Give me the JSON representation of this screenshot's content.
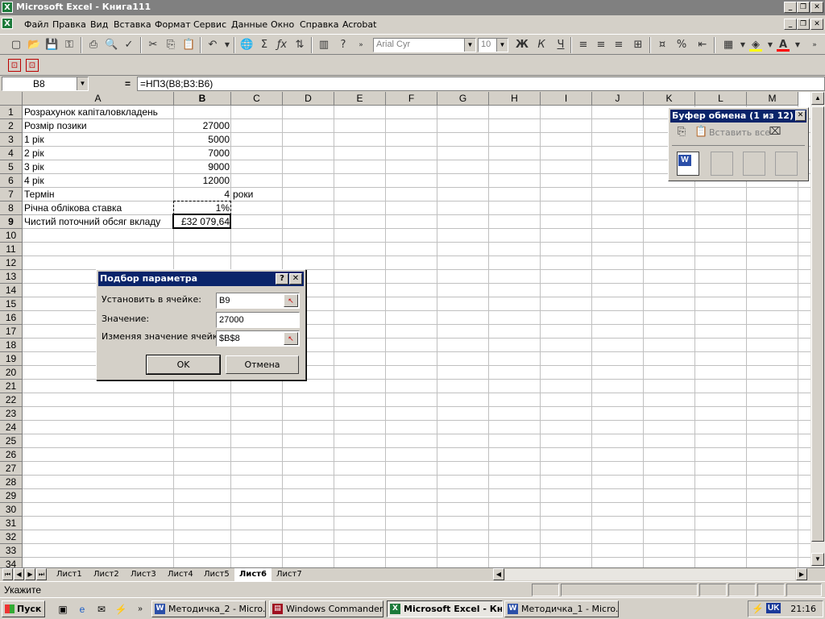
{
  "window": {
    "title": "Microsoft Excel - Книга111",
    "app_icon": "excel-icon"
  },
  "menu": [
    "Файл",
    "Правка",
    "Вид",
    "Вставка",
    "Формат",
    "Сервис",
    "Данные",
    "Окно",
    "Справка",
    "Acrobat"
  ],
  "toolbar": {
    "font_name": "Arial Cyr",
    "font_size": "10"
  },
  "formula_bar": {
    "name_box": "B8",
    "equals": "=",
    "formula": "=НПЗ(B8;B3:B6)"
  },
  "columns": [
    "A",
    "B",
    "C",
    "D",
    "E",
    "F",
    "G",
    "H",
    "I",
    "J",
    "K",
    "L",
    "M"
  ],
  "rows": [
    "1",
    "2",
    "3",
    "4",
    "5",
    "6",
    "7",
    "8",
    "9",
    "10",
    "11",
    "12",
    "13",
    "14",
    "15",
    "16",
    "17",
    "18",
    "19",
    "20",
    "21",
    "22",
    "23",
    "24",
    "25",
    "26",
    "27",
    "28",
    "29",
    "30",
    "31",
    "32",
    "33",
    "34"
  ],
  "cells": {
    "A1": "Розрахунок капіталовкладень",
    "A2": "Розмір позики",
    "B2": "27000",
    "A3": "1 рік",
    "B3": "5000",
    "A4": "2 рік",
    "B4": "7000",
    "A5": "3 рік",
    "B5": "9000",
    "A6": "4 рік",
    "B6": "12000",
    "A7": "Термін",
    "B7": "4",
    "C7": "роки",
    "A8": "Річна облікова ставка",
    "B8": "1%",
    "A9": "Чистий поточний обсяг вкладу",
    "B9": "£32 079,64"
  },
  "dialog": {
    "title": "Подбор параметра",
    "set_cell_label": "Установить в ячейке:",
    "set_cell_value": "B9",
    "value_label": "Значение:",
    "value_value": "27000",
    "changing_label": "Изменяя значение ячейки:",
    "changing_value": "$B$8",
    "ok": "OK",
    "cancel": "Отмена"
  },
  "clipboard": {
    "title": "Буфер обмена (1 из 12)",
    "paste_all": "Вставить все"
  },
  "sheets": [
    "Лист1",
    "Лист2",
    "Лист3",
    "Лист4",
    "Лист5",
    "Лист6",
    "Лист7"
  ],
  "active_sheet": "Лист6",
  "status": "Укажите",
  "taskbar": {
    "start": "Пуск",
    "tasks": [
      "Методичка_2 - Micro...",
      "Windows Commander ...",
      "Microsoft Excel - Кн...",
      "Методичка_1 - Micro..."
    ],
    "lang": "UK",
    "clock": "21:16"
  }
}
